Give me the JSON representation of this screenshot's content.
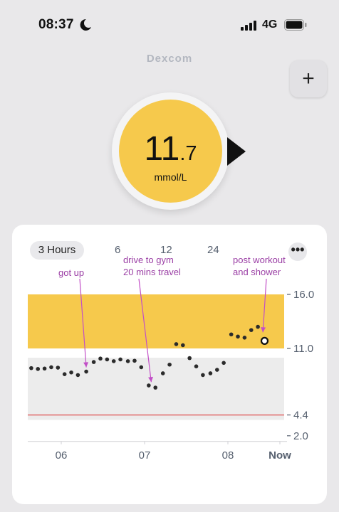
{
  "status_bar": {
    "time": "08:37",
    "network": "4G"
  },
  "brand": "Dexcom",
  "add_button_label": "+",
  "reading": {
    "value_int": "11",
    "value_dec": ".7",
    "unit": "mmol/L",
    "color": "#f6c94c"
  },
  "tabs": [
    "3 Hours",
    "6",
    "12",
    "24"
  ],
  "more_label": "•••",
  "chart_data": {
    "type": "scatter",
    "x_labels": [
      "06",
      "07",
      "08",
      "Now"
    ],
    "y_ticks": [
      16.0,
      11.0,
      4.4,
      2.0
    ],
    "y_tick_labels": [
      "16.0",
      "11.0",
      "4.4",
      "2.0"
    ],
    "high_range": [
      11.0,
      16.0
    ],
    "low_threshold": 4.4,
    "colors": {
      "high": "#f6c94c",
      "target": "#ececec",
      "low_line": "#e05a5a",
      "point": "#2b2b2b",
      "annotation": "#c24fc7"
    },
    "points": [
      [
        0.14,
        9.8
      ],
      [
        0.22,
        9.7
      ],
      [
        0.3,
        9.75
      ],
      [
        0.38,
        9.9
      ],
      [
        0.46,
        9.85
      ],
      [
        0.54,
        9.1
      ],
      [
        0.62,
        9.3
      ],
      [
        0.7,
        9.0
      ],
      [
        0.8,
        9.4
      ],
      [
        0.89,
        10.5
      ],
      [
        0.97,
        10.9
      ],
      [
        1.05,
        10.8
      ],
      [
        1.13,
        10.6
      ],
      [
        1.21,
        10.8
      ],
      [
        1.3,
        10.6
      ],
      [
        1.38,
        10.65
      ],
      [
        1.46,
        9.9
      ],
      [
        1.55,
        7.8
      ],
      [
        1.63,
        7.55
      ],
      [
        1.72,
        9.2
      ],
      [
        1.8,
        10.2
      ],
      [
        1.88,
        11.4
      ],
      [
        1.96,
        11.3
      ],
      [
        2.04,
        10.95
      ],
      [
        2.12,
        10.0
      ],
      [
        2.2,
        9.0
      ],
      [
        2.29,
        9.2
      ],
      [
        2.37,
        9.6
      ],
      [
        2.45,
        10.4
      ],
      [
        2.54,
        12.3
      ],
      [
        2.62,
        12.1
      ],
      [
        2.7,
        12.0
      ],
      [
        2.78,
        12.7
      ],
      [
        2.86,
        13.0
      ]
    ],
    "current": [
      2.94,
      11.7
    ],
    "annotations": [
      {
        "lines": [
          "got up"
        ],
        "target": [
          0.8,
          9.4
        ]
      },
      {
        "lines": [
          "drive to gym",
          "20 mins travel"
        ],
        "target": [
          1.58,
          7.7
        ]
      },
      {
        "lines": [
          "post workout",
          "and shower"
        ],
        "target": [
          2.92,
          12.1
        ]
      }
    ]
  }
}
